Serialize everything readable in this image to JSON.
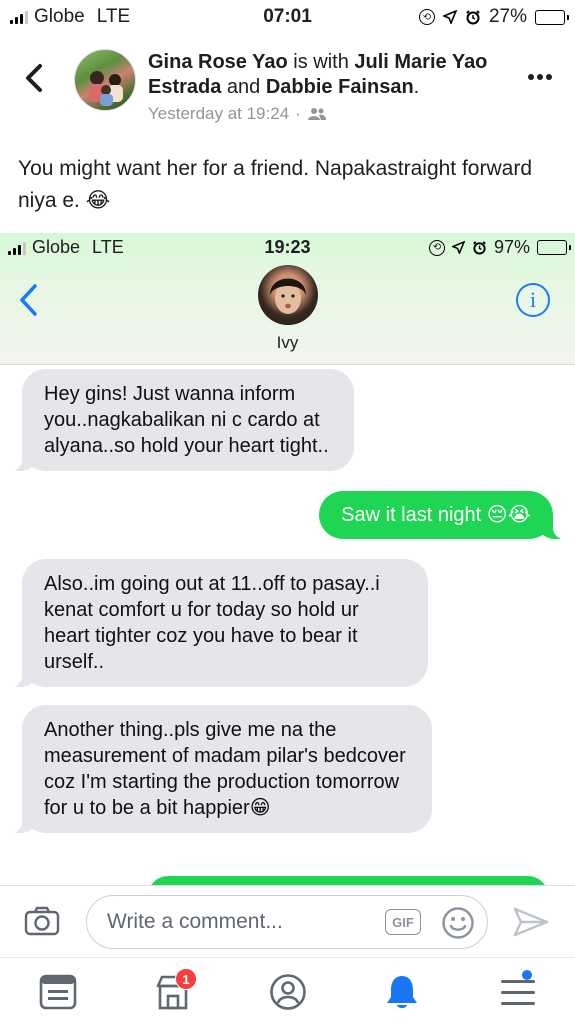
{
  "status_bar": {
    "carrier": "Globe",
    "network": "LTE",
    "time": "07:01",
    "battery_percent": "27%",
    "battery_level": 0.27
  },
  "post": {
    "author": "Gina Rose Yao",
    "with_text": " is with ",
    "tagged_1": "Juli Marie Yao Estrada",
    "and_text": " and ",
    "tagged_2": "Dabbie Fainsan",
    "period": ".",
    "timestamp": "Yesterday at 19:24",
    "separator": "·",
    "privacy_icon": "friends-icon",
    "text": "You might want her for a friend. Napakastraight forward niya e. 😂"
  },
  "screenshot": {
    "status_bar": {
      "carrier": "Globe",
      "network": "LTE",
      "time": "19:23",
      "battery_percent": "97%",
      "battery_level": 0.97
    },
    "contact_name": "Ivy",
    "info_label": "i",
    "messages": [
      {
        "direction": "in",
        "text": "Hey gins! Just wanna inform you..nagkabalikan ni c cardo at alyana..so hold your heart tight.."
      },
      {
        "direction": "out",
        "text": "Saw it last night 😔😭"
      },
      {
        "direction": "in",
        "text": "Also..im going out at 11..off to pasay..i kenat comfort u for today so hold ur heart tighter coz you have to bear it urself.."
      },
      {
        "direction": "in",
        "text": "Another thing..pls give me na the measurement of madam pilar's bedcover coz I'm starting the production tomorrow for u to be a bit happier😁"
      }
    ],
    "colors": {
      "incoming": "#e5e5ea",
      "outgoing": "#1fd654",
      "ios_blue": "#1a7cf5"
    }
  },
  "comment_bar": {
    "placeholder": "Write a comment...",
    "gif_label": "GIF"
  },
  "tab_bar": {
    "items": [
      {
        "name": "news-feed",
        "icon": "newsfeed-icon"
      },
      {
        "name": "marketplace",
        "icon": "marketplace-icon",
        "badge": "1"
      },
      {
        "name": "profile",
        "icon": "profile-icon"
      },
      {
        "name": "notifications",
        "icon": "bell-icon",
        "active": true
      },
      {
        "name": "menu",
        "icon": "hamburger-icon",
        "dot": true
      }
    ]
  },
  "colors": {
    "fb_blue": "#1877f2",
    "badge_red": "#fa3e3e",
    "text_secondary": "#90949c"
  }
}
